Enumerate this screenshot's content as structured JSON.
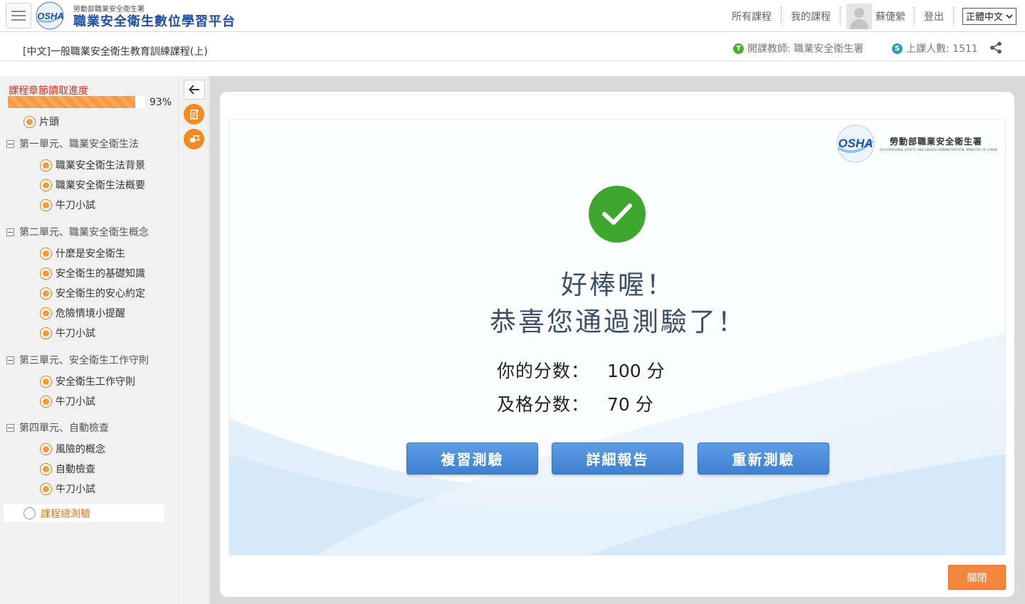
{
  "header": {
    "brand_small": "勞動部職業安全衛生署",
    "brand_main": "職業安全衛生數位學習平台",
    "logo_text": "OSHA",
    "nav": {
      "all_courses": "所有課程",
      "my_courses": "我的課程",
      "user_name": "蘇倢縈",
      "logout": "登出",
      "language": "正體中文"
    }
  },
  "course": {
    "title": "[中文]一般職業安全衛生教育訓練課程(上)",
    "teacher_icon": "T",
    "teacher": "開課教師: 職業安全衛生署",
    "students_icon": "S",
    "students": "上課人數: 1511"
  },
  "sidebar": {
    "progress_label": "課程章節讀取進度",
    "progress_value": 0.93,
    "progress_text": "93%",
    "intro": "片頭",
    "units": [
      {
        "label": "第一單元、職業安全衛生法",
        "items": [
          "職業安全衛生法背景",
          "職業安全衛生法概要",
          "牛刀小試"
        ]
      },
      {
        "label": "第二單元、職業安全衛生概念",
        "items": [
          "什麼是安全衛生",
          "安全衛生的基礎知識",
          "安全衛生的安心約定",
          "危險情境小提醒",
          "牛刀小試"
        ]
      },
      {
        "label": "第三單元、安全衛生工作守則",
        "items": [
          "安全衛生工作守則",
          "牛刀小試"
        ]
      },
      {
        "label": "第四單元、自動檢查",
        "items": [
          "風險的概念",
          "自動檢查",
          "牛刀小試"
        ]
      }
    ],
    "final_exam": "課程總測驗"
  },
  "quiz_result": {
    "agency_name": "勞動部職業安全衛生署",
    "agency_en": "OCCUPATIONAL SAFETY AND HEALTH ADMINISTRATION, MINISTRY OF LABOR",
    "logo_text": "OSHA",
    "message_line1": "好棒喔！",
    "message_line2": "恭喜您通過測驗了！",
    "score_label": "你的分数：",
    "score_value": "100 分",
    "pass_label": "及格分数：",
    "pass_value": "70 分",
    "buttons": {
      "review": "複習測驗",
      "report": "詳細報告",
      "retake": "重新測驗"
    }
  },
  "modal": {
    "close_label": "關閉"
  },
  "colors": {
    "progress_fill": "#f59a43",
    "accent_orange": "#f08a24",
    "success_green": "#3fa62f",
    "button_blue": "#4a8bd9",
    "brand_blue": "#1f4fa3"
  }
}
